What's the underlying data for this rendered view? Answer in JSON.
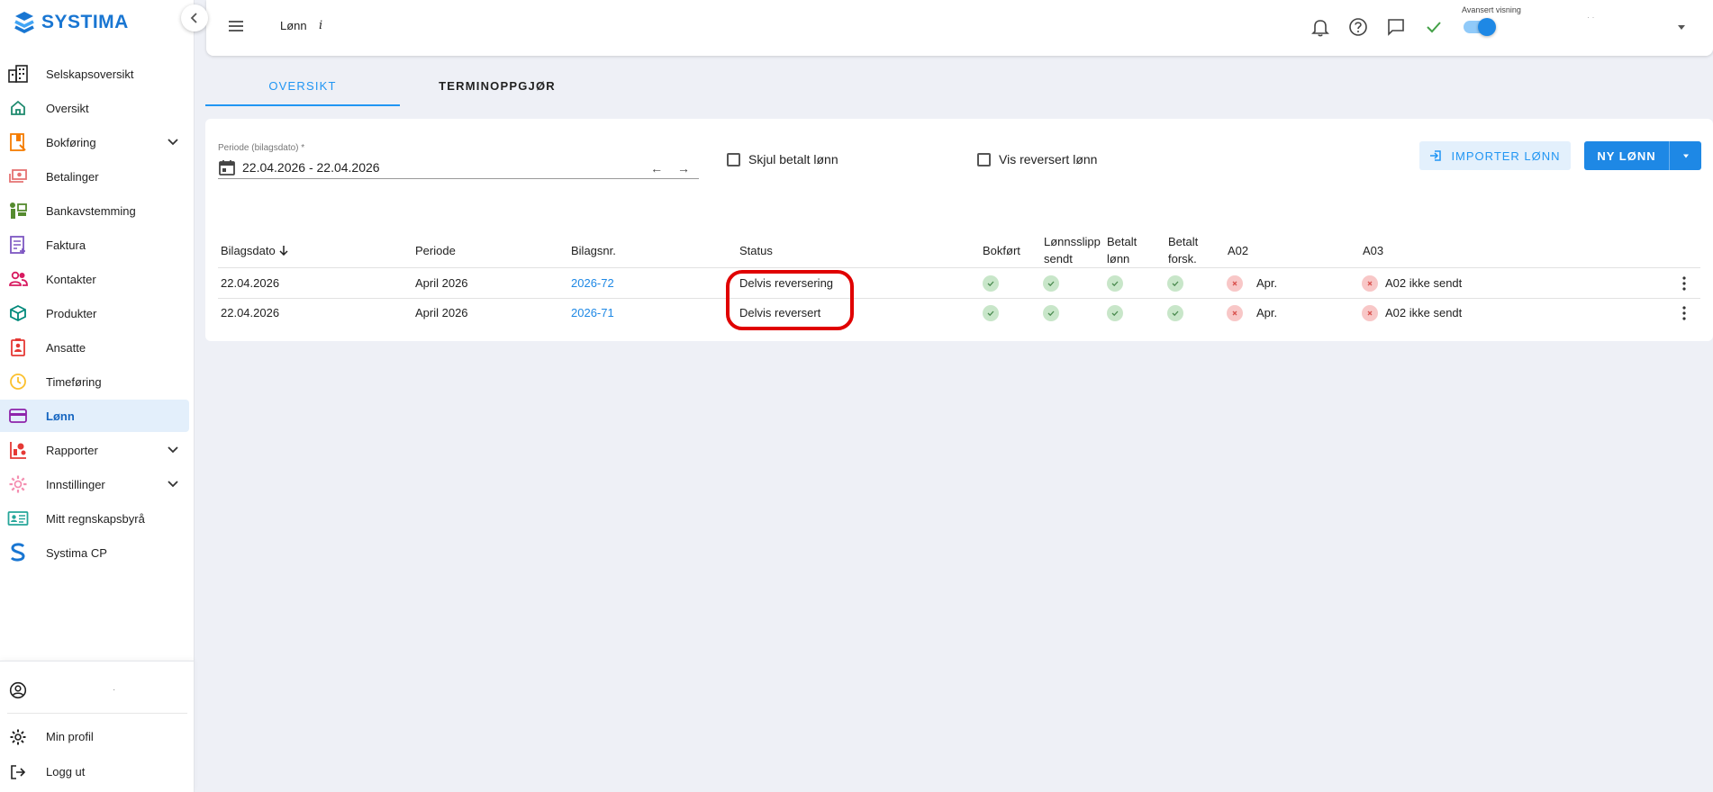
{
  "app": {
    "logo_text": "SYSTIMA"
  },
  "sidebar": {
    "items": [
      {
        "label": "Selskapsoversikt",
        "icon": "buildings-icon",
        "color": "#222222"
      },
      {
        "label": "Oversikt",
        "icon": "home-icon",
        "color": "#1e8a6e"
      },
      {
        "label": "Bokføring",
        "icon": "bookkeeping-icon",
        "color": "#f57c00",
        "expandable": true
      },
      {
        "label": "Betalinger",
        "icon": "money-icon",
        "color": "#e57373"
      },
      {
        "label": "Bankavstemming",
        "icon": "bank-icon",
        "color": "#558b2f"
      },
      {
        "label": "Faktura",
        "icon": "invoice-icon",
        "color": "#7e57c2"
      },
      {
        "label": "Kontakter",
        "icon": "contacts-icon",
        "color": "#d81b60"
      },
      {
        "label": "Produkter",
        "icon": "box-icon",
        "color": "#00897b"
      },
      {
        "label": "Ansatte",
        "icon": "badge-icon",
        "color": "#e53935"
      },
      {
        "label": "Timeføring",
        "icon": "clock-icon",
        "color": "#fbc02d"
      },
      {
        "label": "Lønn",
        "icon": "card-icon",
        "color": "#8e24aa",
        "active": true
      },
      {
        "label": "Rapporter",
        "icon": "reports-icon",
        "color": "#e53935",
        "expandable": true
      },
      {
        "label": "Innstillinger",
        "icon": "settings-icon",
        "color": "#f48fb1",
        "expandable": true
      },
      {
        "label": "Mitt regnskapsbyrå",
        "icon": "id-card-icon",
        "color": "#26a69a"
      },
      {
        "label": "Systima CP",
        "icon": "systima-icon",
        "color": "#1976d2"
      }
    ],
    "bottom": {
      "user_name": "·",
      "profile_label": "Min profil",
      "logout_label": "Logg ut"
    }
  },
  "topbar": {
    "title": "Lønn",
    "info": "i",
    "advanced_label": "Avansert visning",
    "advanced_on": true,
    "user_name": "· ·"
  },
  "tabs": [
    {
      "label": "OVERSIKT",
      "active": true
    },
    {
      "label": "TERMINOPPGJØR",
      "active": false
    }
  ],
  "filters": {
    "period_label": "Periode (bilagsdato) *",
    "period_value": "22.04.2026 - 22.04.2026",
    "arrows": "← →",
    "hide_paid_label": "Skjul betalt lønn",
    "show_reversed_label": "Vis reversert lønn"
  },
  "actions": {
    "import_label": "IMPORTER LØNN",
    "new_label": "NY LØNN"
  },
  "table": {
    "headers": {
      "bilagsdato": "Bilagsdato",
      "periode": "Periode",
      "bilagsnr": "Bilagsnr.",
      "status": "Status",
      "bokfort": "Bokført",
      "lonnsslipp_1": "Lønnsslipp",
      "lonnsslipp_2": "sendt",
      "betalt_lonn_1": "Betalt",
      "betalt_lonn_2": "lønn",
      "betalt_forsk_1": "Betalt",
      "betalt_forsk_2": "forsk.",
      "a02": "A02",
      "a03": "A03"
    },
    "rows": [
      {
        "bilagsdato": "22.04.2026",
        "periode": "April 2026",
        "bilagsnr": "2026-72",
        "status": "Delvis reversering",
        "bokfort": true,
        "lonnsslipp": true,
        "betalt_lonn": true,
        "betalt_forsk": true,
        "a02": "Apr.",
        "a03": "A02 ikke sendt"
      },
      {
        "bilagsdato": "22.04.2026",
        "periode": "April 2026",
        "bilagsnr": "2026-71",
        "status": "Delvis reversert",
        "bokfort": true,
        "lonnsslipp": true,
        "betalt_lonn": true,
        "betalt_forsk": true,
        "a02": "Apr.",
        "a03": "A02 ikke sendt"
      }
    ]
  },
  "colors": {
    "accent": "#1e88e5",
    "highlight": "#e00000",
    "ok": "#c8e6c9",
    "error": "#f8c7c7"
  }
}
